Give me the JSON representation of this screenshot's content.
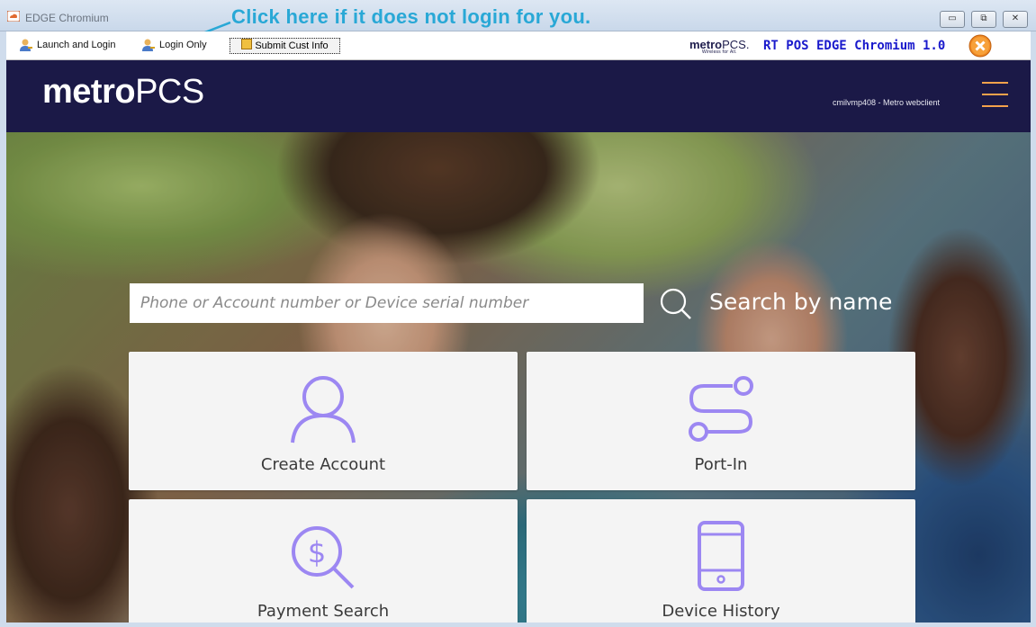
{
  "window": {
    "title": "EDGE Chromium",
    "buttons": {
      "minimize": "▭",
      "restore": "⧉",
      "close": "✕"
    }
  },
  "callout": {
    "text": "Click here if it does not login for you."
  },
  "toolbar": {
    "launch_login": "Launch and Login",
    "login_only": "Login Only",
    "submit_cust_info": "Submit Cust Info",
    "mini_logo_big": "metro",
    "mini_logo_pcs": "PCS.",
    "mini_logo_tag": "Wireless for All.",
    "pos_title": "RT POS EDGE Chromium 1.0"
  },
  "header": {
    "brand_bold": "metro",
    "brand_light": "PCS",
    "user_label": "cmilvmp408 - Metro webclient"
  },
  "search": {
    "placeholder": "Phone or Account number or Device serial number",
    "by_name_label": "Search by name"
  },
  "tiles": [
    {
      "label": "Create Account",
      "icon": "person-icon"
    },
    {
      "label": "Port-In",
      "icon": "route-icon"
    },
    {
      "label": "Payment Search",
      "icon": "dollar-search-icon"
    },
    {
      "label": "Device History",
      "icon": "phone-icon"
    }
  ],
  "colors": {
    "navy": "#1b1947",
    "accent_orange": "#f4a24b",
    "tile_icon": "#9c87f2",
    "callout_blue": "#29a8d6",
    "pos_title_blue": "#1a1acc"
  }
}
